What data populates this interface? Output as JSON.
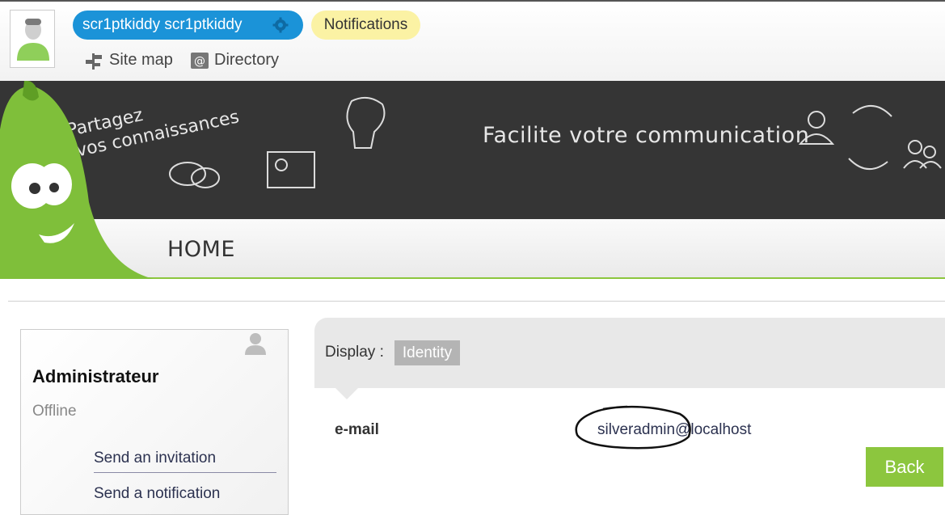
{
  "topbar": {
    "user_name": "scr1ptkiddy scr1ptkiddy",
    "notifications_label": "Notifications",
    "sitemap_label": "Site map",
    "directory_label": "Directory"
  },
  "banner": {
    "tag_line1": "Partagez",
    "tag_line2": "vos connaissances",
    "tagline": "Facilite votre communication"
  },
  "nav": {
    "home_label": "HOME"
  },
  "profile_card": {
    "name": "Administrateur",
    "status": "Offline",
    "send_invitation": "Send an invitation",
    "send_notification": "Send a notification"
  },
  "details": {
    "display_label": "Display :",
    "identity_tab": "Identity",
    "email_label": "e-mail",
    "email_value": "silveradmin@localhost",
    "back_label": "Back"
  },
  "colors": {
    "user_pill": "#1b93d8",
    "notifications_pill": "#fbf2a4",
    "banner_bg": "#353535",
    "accent_green": "#8cc63e"
  },
  "icons": {
    "gear": "gear-icon",
    "sitemap": "sitemap-icon",
    "directory": "directory-icon",
    "profile": "user-silhouette-icon"
  }
}
